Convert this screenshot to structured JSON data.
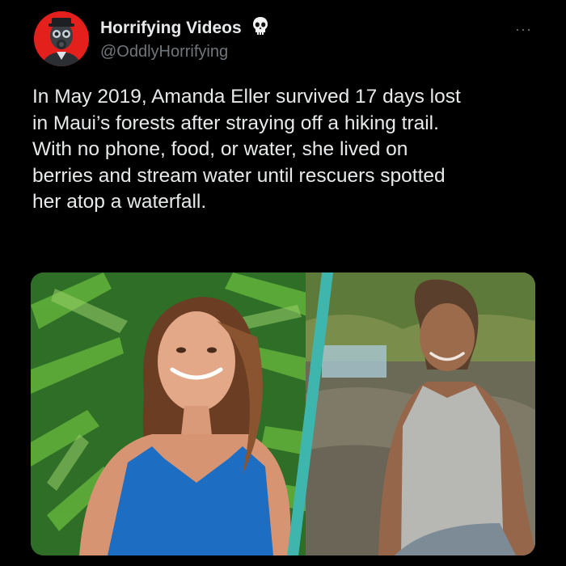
{
  "post": {
    "display_name": "Horrifying Videos",
    "handle": "@OddlyHorrifying",
    "more_label": "···",
    "text": "In May 2019, Amanda Eller survived 17 days lost\nin Maui’s forests after straying off a hiking trail.\nWith no phone, food, or water, she lived on\nberries and stream water until rescuers spotted\nher atop a waterfall."
  },
  "icons": {
    "avatar": "gas-mask-avatar",
    "badge": "skull-icon",
    "more": "more-options-icon"
  },
  "colors": {
    "background": "#000000",
    "text": "#e7e9ea",
    "muted": "#71767b",
    "avatar_red": "#e3201b",
    "divider_teal": "#3fb6ad"
  }
}
